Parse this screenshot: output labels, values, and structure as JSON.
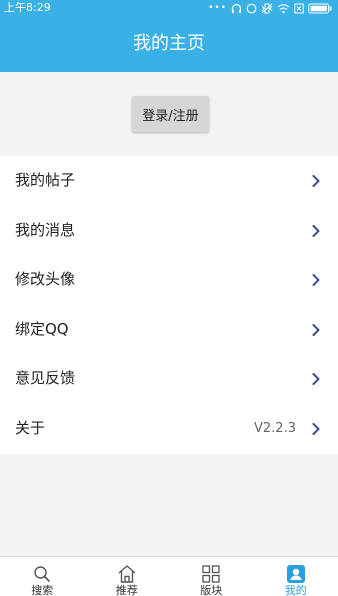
{
  "status_bar": {
    "time": "上午8:29",
    "dots": "•••"
  },
  "header": {
    "title": "我的主页"
  },
  "login": {
    "label": "登录/注册"
  },
  "menu": {
    "items": [
      {
        "label": "我的帖子"
      },
      {
        "label": "我的消息"
      },
      {
        "label": "修改头像"
      },
      {
        "label": "绑定QQ"
      },
      {
        "label": "意见反馈"
      },
      {
        "label": "关于",
        "value": "V2.2.3"
      }
    ]
  },
  "bottom_nav": {
    "tabs": [
      {
        "label": "搜索",
        "icon": "search-icon"
      },
      {
        "label": "推荐",
        "icon": "home-icon"
      },
      {
        "label": "版块",
        "icon": "grid-icon"
      },
      {
        "label": "我的",
        "icon": "user-icon",
        "active": true
      }
    ]
  },
  "colors": {
    "primary": "#39b0e6",
    "active_tab": "#2a9fe0",
    "chevron": "#3b4f8c"
  }
}
